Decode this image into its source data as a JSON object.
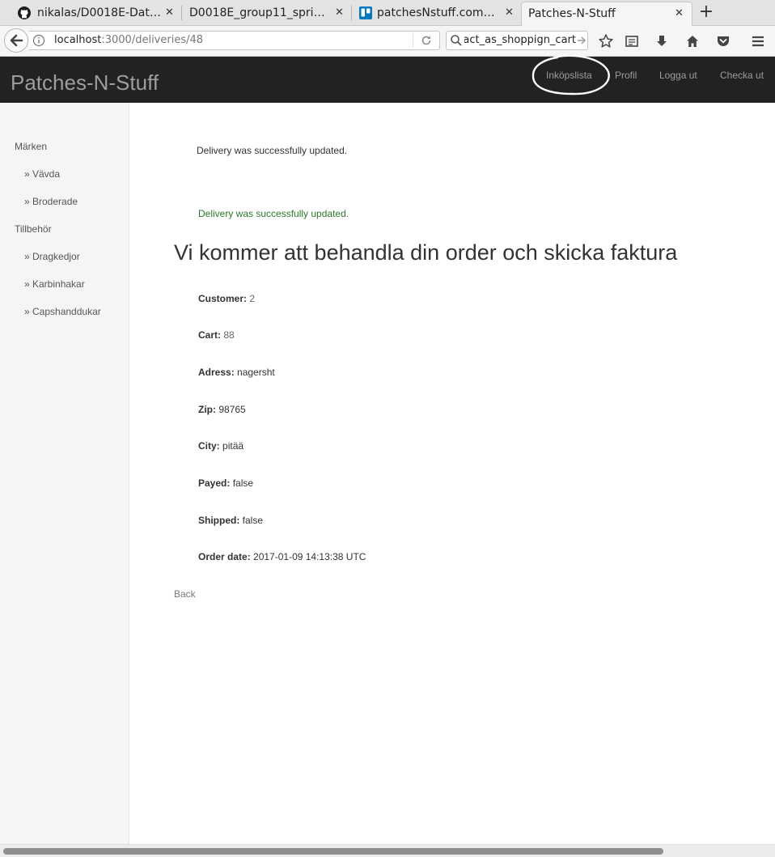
{
  "browser": {
    "tabs": [
      {
        "title": "nikalas/D0018E-Datab…",
        "icon": "github-icon",
        "active": false
      },
      {
        "title": "D0018E_group11_sprint4…",
        "icon": "none",
        "active": false
      },
      {
        "title": "patchesNstuff.com | …",
        "icon": "trello-icon",
        "active": false
      },
      {
        "title": "Patches-N-Stuff",
        "icon": "none",
        "active": true
      }
    ],
    "new_tab_label": "+",
    "url_host": "localhost",
    "url_path": ":3000/deliveries/48",
    "search_value": "act_as_shoppign_cart"
  },
  "site": {
    "brand": "Patches-N-Stuff",
    "nav": [
      "Inköpslista",
      "Profil",
      "Logga ut",
      "Checka ut"
    ]
  },
  "sidebar": {
    "sections": [
      {
        "label": "Märken",
        "items": [
          "» Vävda",
          "» Broderade"
        ]
      },
      {
        "label": "Tillbehör",
        "items": [
          "» Dragkedjor",
          "» Karbinhakar",
          "» Capshanddukar"
        ]
      }
    ]
  },
  "main": {
    "notice": "Delivery was successfully updated.",
    "flash_success": "Delivery was successfully updated.",
    "title": "Vi kommer att behandla din order och skicka faktura",
    "fields": [
      {
        "label": "Customer:",
        "value": "2"
      },
      {
        "label": "Cart:",
        "value": "88"
      },
      {
        "label": "Adress:",
        "value": "nagersht"
      },
      {
        "label": "Zip:",
        "value": "98765"
      },
      {
        "label": "City:",
        "value": "pitää"
      },
      {
        "label": "Payed:",
        "value": "false"
      },
      {
        "label": "Shipped:",
        "value": "false"
      },
      {
        "label": "Order date:",
        "value": "2017-01-09 14:13:38 UTC"
      }
    ],
    "back_label": "Back"
  },
  "colors": {
    "header_bg": "#222222",
    "header_text": "#9d9d9d",
    "sidebar_bg": "#f5f5f5",
    "success_text": "#2a7a2a"
  }
}
